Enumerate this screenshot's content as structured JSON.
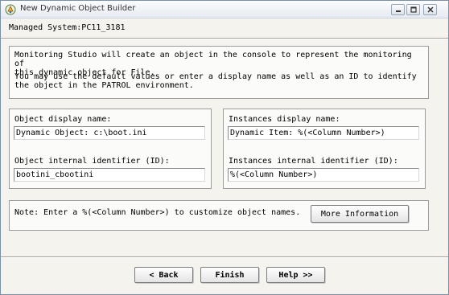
{
  "window": {
    "title": "New Dynamic Object Builder"
  },
  "managed_system": "Managed System:PC11_3181",
  "info": {
    "paragraph1": "Monitoring Studio will create an object in the console to represent the monitoring of\nthis dynamic object for File.",
    "paragraph2": "You may use the default values or enter a display name as well as an ID to identify\nthe object in the PATROL environment."
  },
  "object": {
    "display_label": "Object display name:",
    "display_value": "Dynamic Object: c:\\boot.ini",
    "id_label": "Object internal identifier (ID):",
    "id_value": "bootini_cbootini"
  },
  "instances": {
    "display_label": "Instances display name:",
    "display_value": "Dynamic Item: %(<Column Number>)",
    "id_label": "Instances internal identifier (ID):",
    "id_value": "%(<Column Number>)"
  },
  "note": {
    "text": "Note: Enter a %(<Column Number>) to customize object names.",
    "more_button": "More Information"
  },
  "footer": {
    "back": "< Back",
    "finish": "Finish",
    "help": "Help >>"
  },
  "icons": {
    "app": "app-icon",
    "minimize": "minimize-icon",
    "maximize": "maximize-icon",
    "close": "close-icon"
  },
  "colors": {
    "window_bg": "#f5f3ee",
    "titlebar": "#e6ebf2",
    "border": "#9c9c9c"
  }
}
